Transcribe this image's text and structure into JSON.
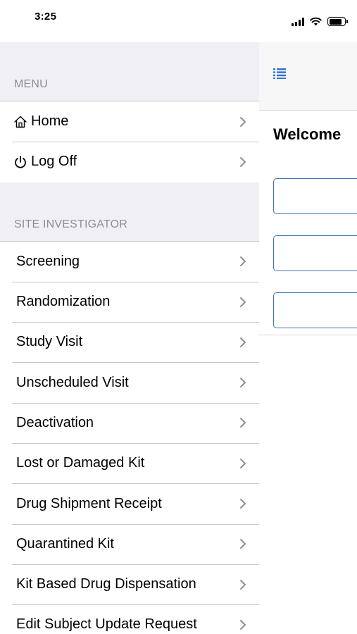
{
  "status_bar": {
    "time": "3:25",
    "icons": [
      "signal-icon",
      "wifi-icon",
      "battery-icon"
    ],
    "battery_level": 0.85
  },
  "side_menu": {
    "menu_section": {
      "header": "MENU",
      "items": [
        {
          "label": "Home",
          "icon": "home-icon"
        },
        {
          "label": "Log Off",
          "icon": "power-icon"
        }
      ]
    },
    "site_section": {
      "header": "SITE INVESTIGATOR",
      "items": [
        {
          "label": "Screening"
        },
        {
          "label": "Randomization"
        },
        {
          "label": "Study Visit"
        },
        {
          "label": "Unscheduled Visit"
        },
        {
          "label": "Deactivation"
        },
        {
          "label": "Lost or Damaged Kit"
        },
        {
          "label": "Drug Shipment Receipt"
        },
        {
          "label": "Quarantined Kit"
        },
        {
          "label": "Kit Based Drug Dispensation"
        },
        {
          "label": "Edit Subject Update Request"
        }
      ]
    }
  },
  "main": {
    "nav_icon": "list-icon",
    "title": "Welcome",
    "fields": [
      {
        "value": ""
      },
      {
        "value": ""
      },
      {
        "value": ""
      }
    ]
  },
  "colors": {
    "accent": "#2f6fd6",
    "field_border": "#3f73b7",
    "menu_background": "#efeff4",
    "section_header_text": "#8e8e93",
    "separator": "#c8c7cc"
  }
}
